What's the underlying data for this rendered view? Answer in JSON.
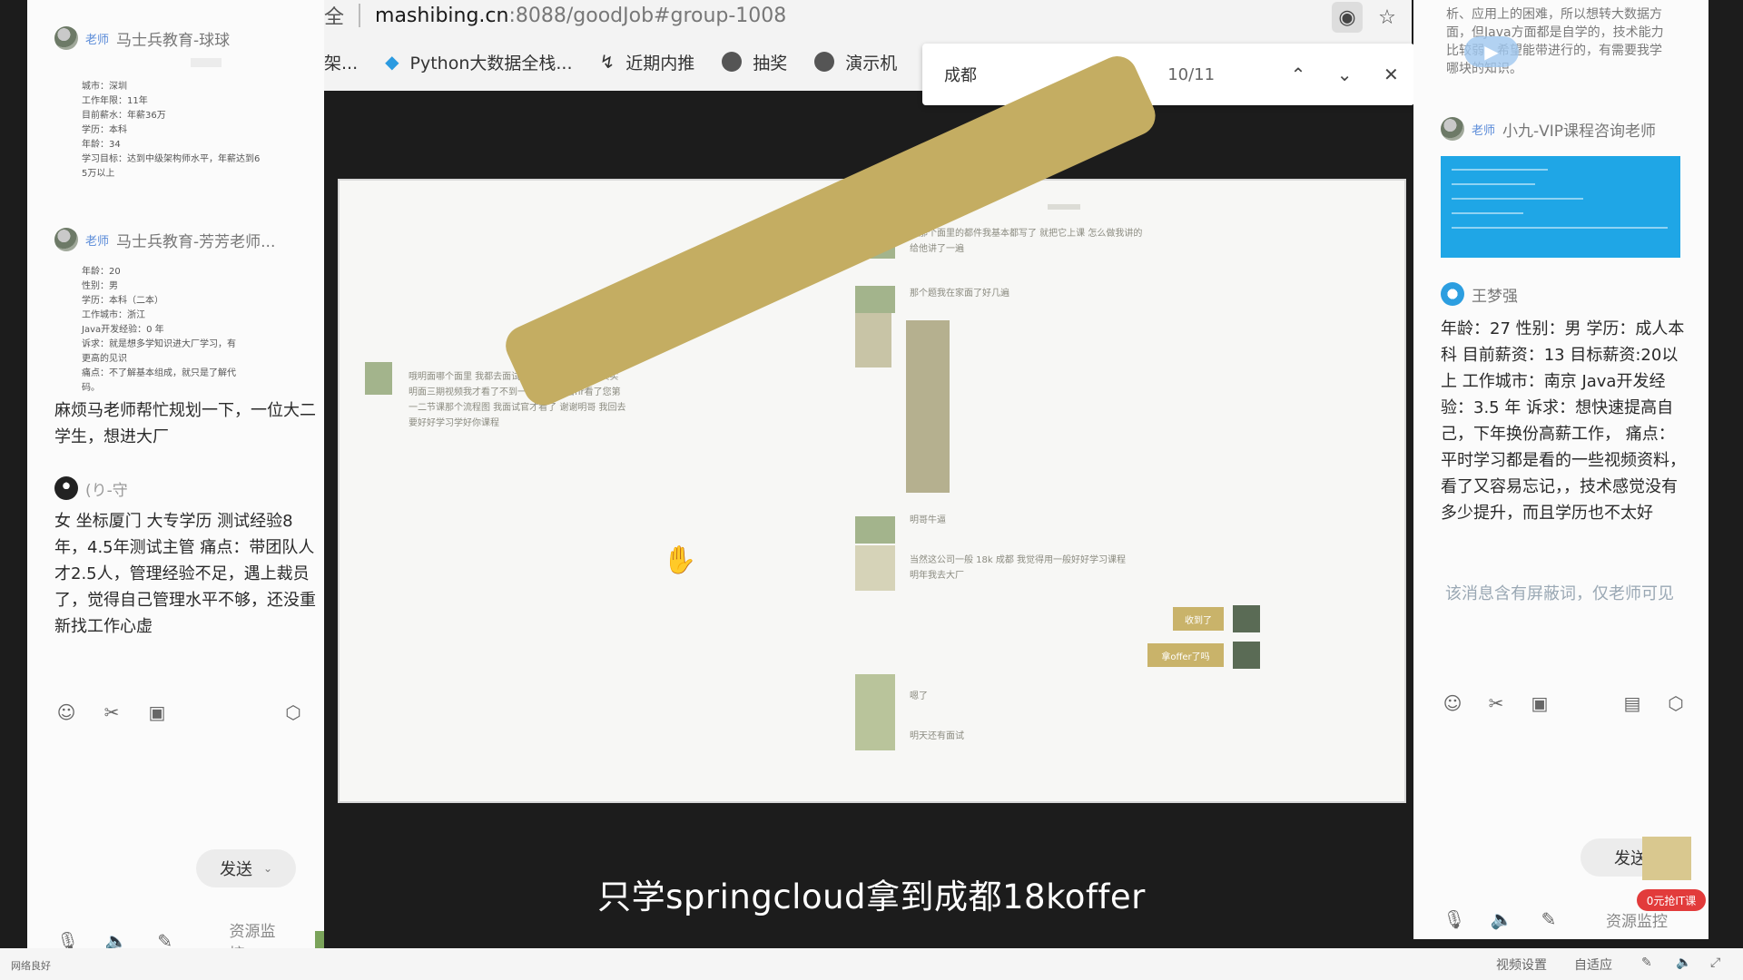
{
  "left_chat": {
    "msg1": {
      "role": "老师",
      "sender": "马士兵教育-球球",
      "card_lines": [
        "城市：深圳",
        "工作年限：11年",
        "目前薪水：年薪36万",
        "学历：本科",
        "年龄：34",
        "学习目标：达到中级架构师水平，年薪达到6",
        "5万以上"
      ]
    },
    "msg2": {
      "role": "老师",
      "sender": "马士兵教育-芳芳老师...",
      "card_lines": [
        "年龄：20",
        "性别：男",
        "学历：本科（二本）",
        "工作城市：浙江",
        "Java开发经验：0 年",
        "诉求：就是想多学知识进大厂学习，有",
        "更高的见识",
        "痛点：不了解基本组成，就只是了解代",
        "码。"
      ],
      "text": "麻烦马老师帮忙规划一下，一位大二学生，想进大厂"
    },
    "msg3": {
      "sender": "(り-守",
      "text": "女 坐标厦门 大专学历 测试经验8年，4.5年测试主管 痛点：带团队人才2.5人，管理经验不足，遇上裁员了，觉得自己管理水平不够，还没重新找工作心虚"
    },
    "send_label": "发送",
    "monitor_label": "资源监控"
  },
  "browser": {
    "url_prefix": "全",
    "url_host": "mashibing.cn",
    "url_path": ":8088/goodJob#group-1008",
    "bookmarks": [
      "架...",
      "Python大数据全栈...",
      "近期内推",
      "抽奖",
      "演示机"
    ],
    "find": {
      "query": "成都",
      "count": "10/11"
    }
  },
  "screen": {
    "messages": {
      "m1": "你那个面里的都件我基本都写了 就把它上课 怎么做我讲的给他讲了一遍",
      "m2": "那个题我在家面了好几遍",
      "m3": "哦明面哪个面里 我都去面试 hr问 springcloud 其实明面三期视频我才看了不到一半 但是我给hr看了您第一二节课那个流程图 我面试官才看了 谢谢明哥 我回去要好好学习学好你课程",
      "m4": "明哥牛逼",
      "m5": "当然这公司一般 18k 成都 我觉得用一般好好学习课程 明年我去大厂",
      "m6": "收到了",
      "m7": "拿offer了吗",
      "m8": "嗯了",
      "m9": "明天还有面试"
    }
  },
  "subtitle": "只学springcloud拿到成都18koffer",
  "right_chat": {
    "top_text": "析、应用上的困难，所以想转大数据方面，但Java方面都是自学的，技术能力比较弱，希望能带进行的，有需要我学哪块的知识。",
    "msg1": {
      "role": "老师",
      "sender": "小九-VIP课程咨询老师"
    },
    "msg2": {
      "sender": "王梦强",
      "text": "年龄：27 性别：男 学历：成人本科 目前薪资：13 目标薪资:20以上 工作城市：南京 Java开发经验：3.5  年 诉求：想快速提高自己，下年换份高薪工作， 痛点：平时学习都是看的一些视频资料，看了又容易忘记，，技术感觉没有多少提升，而且学历也不太好"
    },
    "notice": "该消息含有屏蔽词，仅老师可见",
    "send_label": "发送",
    "promo": "0元抢IT课",
    "monitor_label": "资源监控"
  },
  "status_bar": {
    "left": "网络良好",
    "video_settings": "视频设置",
    "adapt": "自适应"
  }
}
